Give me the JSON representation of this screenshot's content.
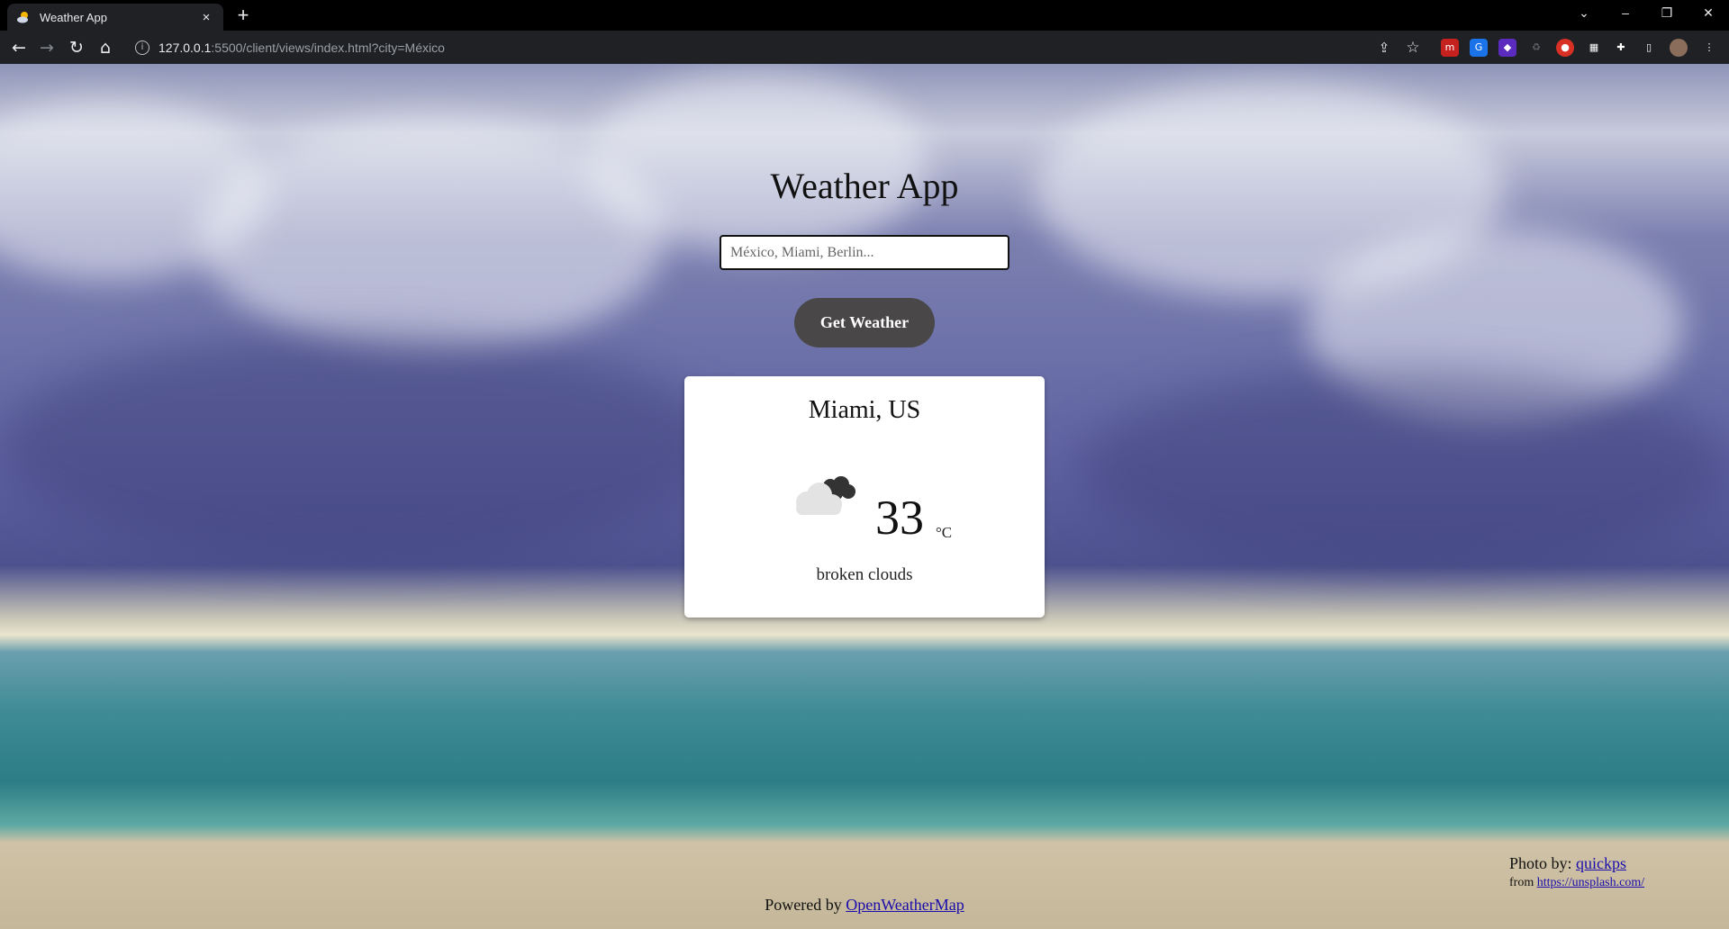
{
  "browser": {
    "tab_title": "Weather App",
    "tab_close": "×",
    "new_tab": "+",
    "url_host": "127.0.0.1",
    "url_rest": ":5500/client/views/index.html?city=México",
    "win_min": "–",
    "win_restore": "❐",
    "win_close": "✕",
    "win_dropdown": "⌄"
  },
  "page": {
    "title": "Weather App",
    "search_placeholder": "México, Miami, Berlin...",
    "button_label": "Get Weather",
    "weather": {
      "city": "Miami, US",
      "temperature": "33",
      "unit": "°C",
      "description": "broken clouds",
      "icon": "broken-clouds-icon"
    },
    "credit": {
      "photo_by": "Photo by:",
      "author": "quickps",
      "from": "from",
      "source": "https://unsplash.com/"
    },
    "footer": {
      "powered_by": "Powered by",
      "provider": "OpenWeatherMap"
    }
  },
  "colors": {
    "button_bg": "#4a4748",
    "link": "#1a0dab",
    "chrome_bg": "#202124"
  }
}
